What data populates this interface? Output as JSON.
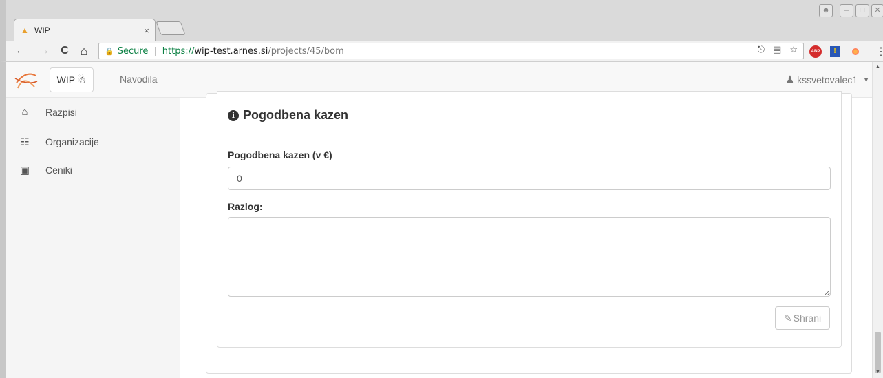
{
  "browser": {
    "tab_title": "WIP",
    "tab_close": "×",
    "back": "←",
    "forward": "→",
    "reload": "C",
    "home": "⌂",
    "secure_label": "Secure",
    "url_scheme": "https://",
    "url_host": "wip-test.arnes.si",
    "url_path": "/projects/45/bom",
    "key_icon": "key-icon",
    "star": "☆",
    "abp_label": "ABP",
    "menu": "⋮"
  },
  "navbar": {
    "brand_label": "WIP",
    "link_navodila": "Navodila",
    "user_name": "kssvetovalec1"
  },
  "sidebar": {
    "items": [
      {
        "label": "Razpisi",
        "icon": "home-icon"
      },
      {
        "label": "Organizacije",
        "icon": "sitemap-icon"
      },
      {
        "label": "Ceniki",
        "icon": "money-icon"
      }
    ]
  },
  "form": {
    "title": "Pogodbena kazen",
    "penalty_label": "Pogodbena kazen (v €)",
    "penalty_value": "0",
    "reason_label": "Razlog:",
    "reason_value": "",
    "save_label": "Shrani"
  },
  "colors": {
    "secure_green": "#0b8043",
    "navbar_bg": "#f8f8f8",
    "sidebar_bg": "#f5f5f5"
  }
}
